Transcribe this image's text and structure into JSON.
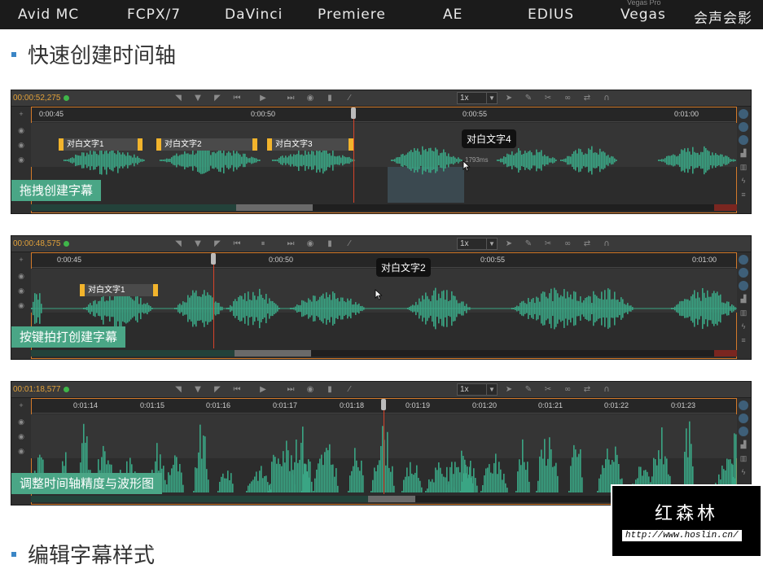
{
  "topnav": {
    "items": [
      "Avid MC",
      "FCPX/7",
      "DaVinci",
      "Premiere",
      "AE",
      "EDIUS",
      "Vegas",
      "会声会影"
    ],
    "vegas_sup": "Vegas Pro"
  },
  "section1": {
    "title": "快速创建时间轴"
  },
  "section2": {
    "title": "编辑字幕样式"
  },
  "panels": [
    {
      "timecode": "00:00:52,275",
      "speed": "1x",
      "ruler_labels": [
        "0:00:45",
        "0:00:50",
        "0:00:55",
        "0:01:00"
      ],
      "captions": [
        "对白文字1",
        "对白文字2",
        "对白文字3"
      ],
      "tooltip": "对白文字4",
      "duration_label": "1793ms",
      "label": "拖拽创建字幕"
    },
    {
      "timecode": "00:00:48,575",
      "speed": "1x",
      "ruler_labels": [
        "0:00:45",
        "0:00:50",
        "0:00:55",
        "0:01:00"
      ],
      "captions": [
        "对白文字1"
      ],
      "tooltip": "对白文字2",
      "label": "按键拍打创建字幕"
    },
    {
      "timecode": "00:01:18,577",
      "speed": "1x",
      "ruler_labels": [
        "0:01:14",
        "0:01:15",
        "0:01:16",
        "0:01:17",
        "0:01:18",
        "0:01:19",
        "0:01:20",
        "0:01:21",
        "0:01:22",
        "0:01:23"
      ],
      "label": "调整时间轴精度与波形图"
    }
  ],
  "watermark": {
    "title": "红森林",
    "url": "http://www.hoslin.cn/"
  },
  "colors": {
    "waveform": "#3aa584",
    "playhead": "#d8432a",
    "timecode": "#e2a13a",
    "caption_edge": "#f2b42c",
    "label_bg": "#4aa686"
  }
}
